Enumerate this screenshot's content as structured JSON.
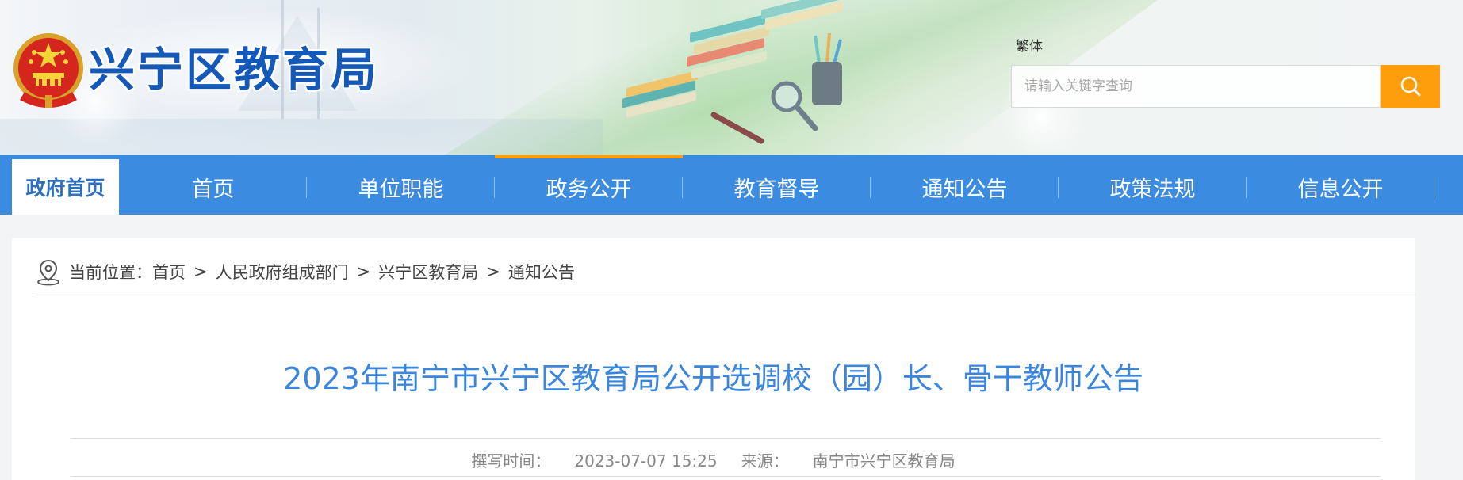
{
  "header": {
    "site_title": "兴宁区教育局",
    "lang_switch": "繁体",
    "search_placeholder": "请输入关键字查询"
  },
  "nav": {
    "home_label": "政府首页",
    "items": [
      {
        "label": "首页"
      },
      {
        "label": "单位职能"
      },
      {
        "label": "政务公开"
      },
      {
        "label": "教育督导"
      },
      {
        "label": "通知公告"
      },
      {
        "label": "政策法规"
      },
      {
        "label": "信息公开"
      }
    ],
    "active_index": 2
  },
  "breadcrumb": {
    "prefix": "当前位置：",
    "items": [
      "首页",
      "人民政府组成部门",
      "兴宁区教育局",
      "通知公告"
    ],
    "separator": ">"
  },
  "article": {
    "title": "2023年南宁市兴宁区教育局公开选调校（园）长、骨干教师公告",
    "written_time_label": "撰写时间：",
    "written_time": "2023-07-07 15:25",
    "source_label": "来源：",
    "source": "南宁市兴宁区教育局"
  },
  "colors": {
    "nav_bg": "#3b8be0",
    "accent_orange": "#ff9e0d",
    "title_blue": "#1459b8",
    "article_title": "#3a86de"
  },
  "icons": {
    "emblem": "national-emblem-icon",
    "search": "search-icon",
    "location": "location-pin-icon"
  }
}
